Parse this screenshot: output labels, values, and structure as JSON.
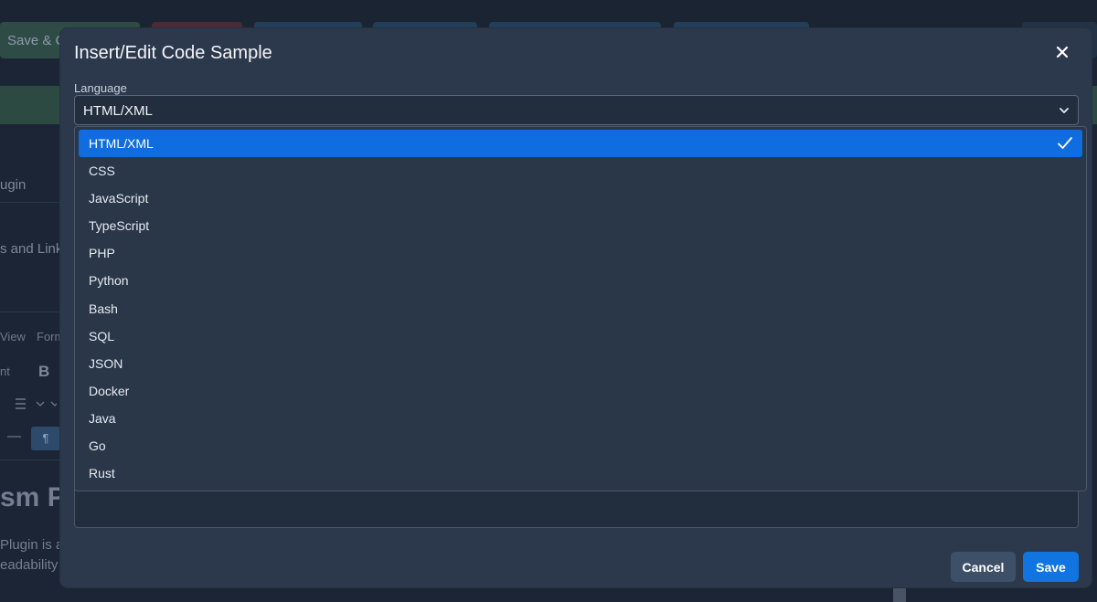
{
  "background": {
    "toolbar": {
      "save_close_label": "Save & C",
      "right_label": ""
    },
    "sidebar": {
      "plugin_label": "ugin",
      "links_label": "s and Link",
      "menu_view": "View",
      "menu_format": "Form",
      "font_label": "nt",
      "bold_label": "B",
      "list_icon": "list-icon",
      "hr_label": "—",
      "para_label": "¶"
    },
    "content": {
      "heading": "sm Pl",
      "para_line_1": "Plugin is a",
      "para_line_2": "eadability"
    }
  },
  "dialog": {
    "title": "Insert/Edit Code Sample",
    "close_icon": "close-icon",
    "language_label": "Language",
    "language_value": "HTML/XML",
    "cancel_label": "Cancel",
    "save_label": "Save",
    "accent_color": "#1075e0"
  },
  "dropdown": {
    "selected_index": 0,
    "options": [
      {
        "label": "HTML/XML"
      },
      {
        "label": "CSS"
      },
      {
        "label": "JavaScript"
      },
      {
        "label": "TypeScript"
      },
      {
        "label": "PHP"
      },
      {
        "label": "Python"
      },
      {
        "label": "Bash"
      },
      {
        "label": "SQL"
      },
      {
        "label": "JSON"
      },
      {
        "label": "Docker"
      },
      {
        "label": "Java"
      },
      {
        "label": "Go"
      },
      {
        "label": "Rust"
      }
    ]
  }
}
